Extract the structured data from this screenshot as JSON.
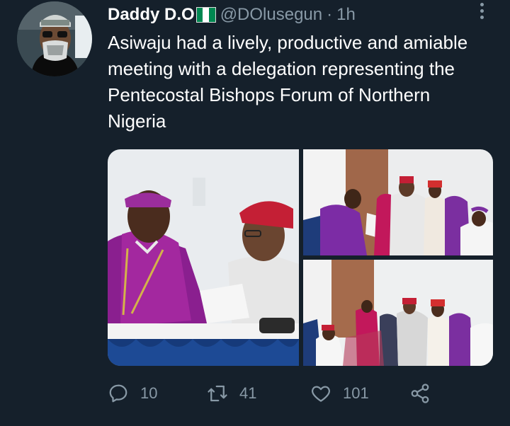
{
  "tweet": {
    "display_name": "Daddy D.O",
    "verified_flag": "nigeria-flag-icon",
    "handle": "@DOlusegun",
    "separator": "·",
    "time": "1h",
    "text": "Asiwaju had a lively, productive and amiable meeting with a delegation representing the Pentecostal Bishops Forum of Northern Nigeria"
  },
  "actions": {
    "reply_count": "10",
    "retweet_count": "41",
    "like_count": "101"
  },
  "icons": {
    "reply": "reply-icon",
    "retweet": "retweet-icon",
    "like": "heart-icon",
    "share": "share-icon",
    "more": "more-vertical-icon"
  },
  "colors": {
    "background": "#15202b",
    "text": "#ffffff",
    "muted": "#8899a6",
    "flag_green": "#008751"
  }
}
